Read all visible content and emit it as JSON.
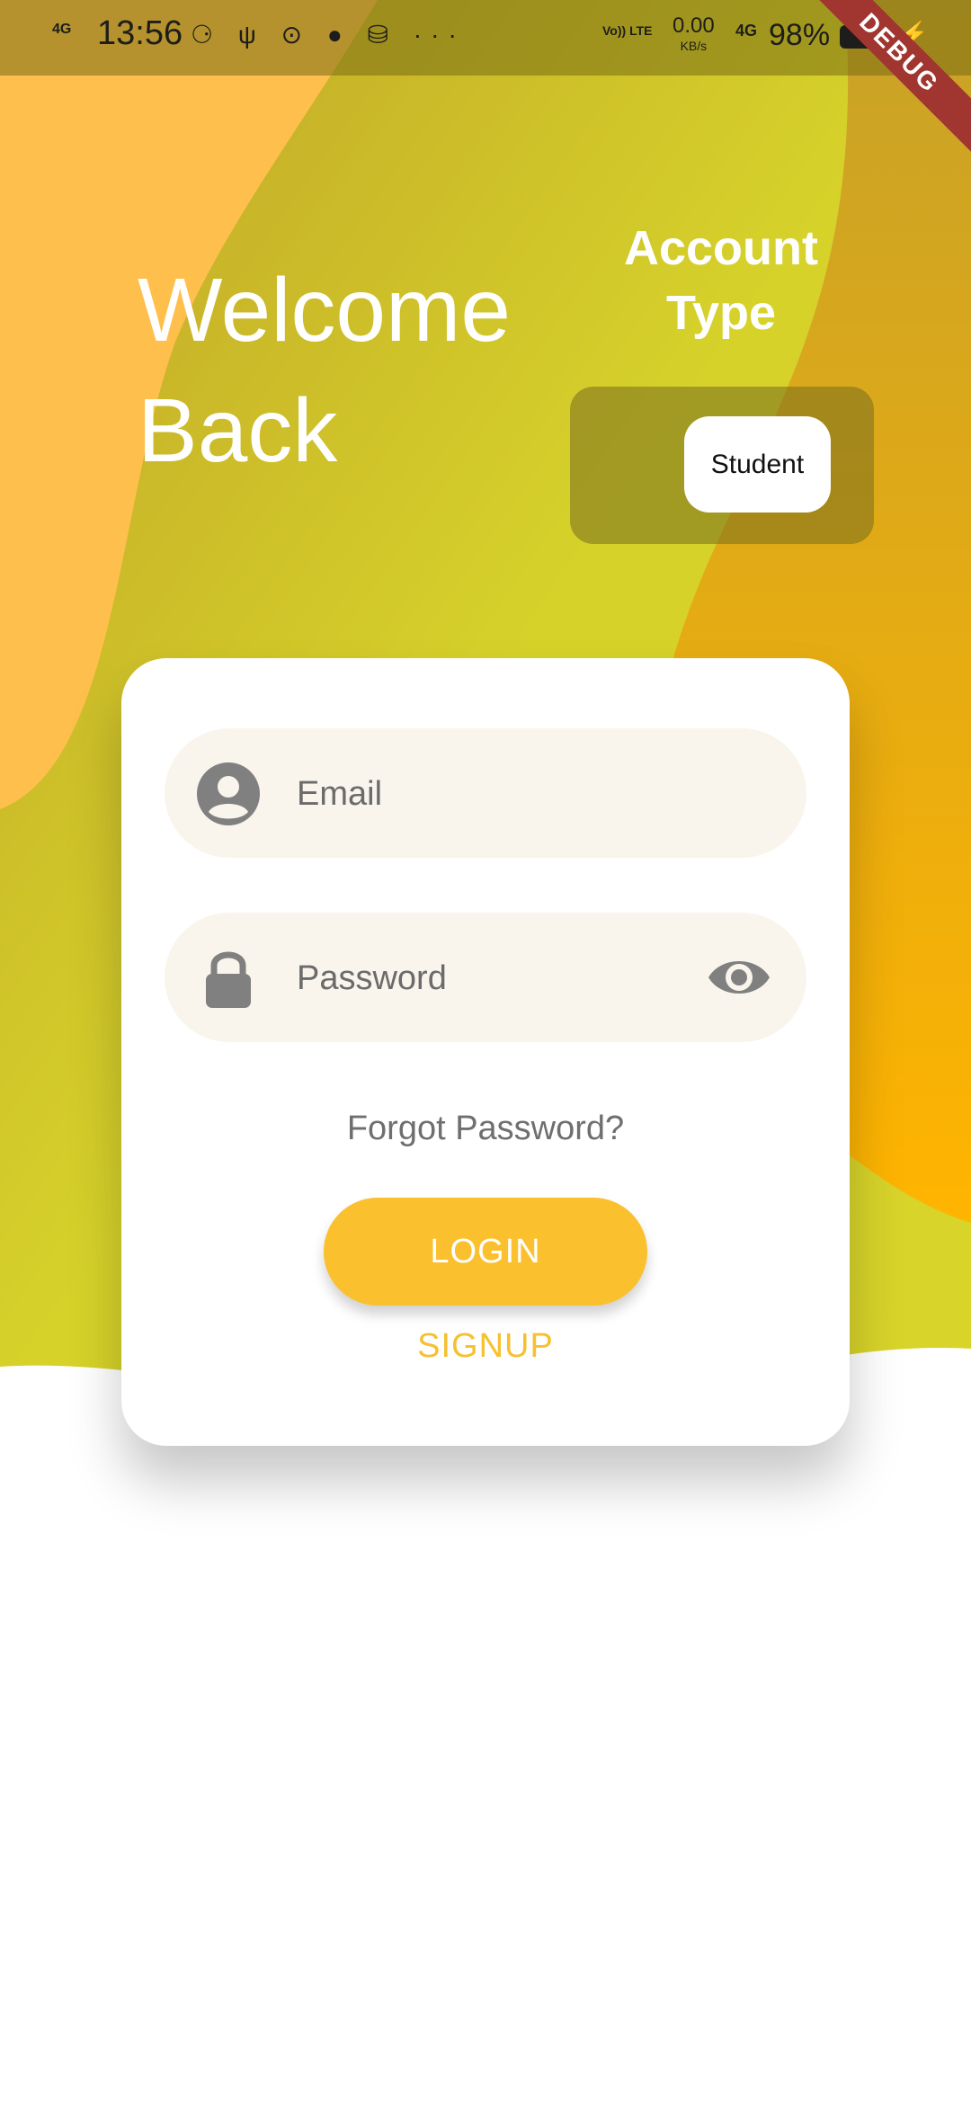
{
  "status_bar": {
    "network_type": "4G",
    "time": "13:56",
    "status_icons": "⚆ ψ ⊙ ● ⛁ ···",
    "net_speed_value": "0.00",
    "net_speed_unit": "KB/s",
    "network_type_right": "4G",
    "battery": "98%",
    "volte": "Vo)) LTE"
  },
  "debug_banner": "DEBUG",
  "welcome": {
    "line1": "Welcome",
    "line2": "Back"
  },
  "account_type": {
    "title_line1": "Account",
    "title_line2": "Type",
    "selected": "Student"
  },
  "form": {
    "email_placeholder": "Email",
    "email_value": "",
    "password_placeholder": "Password",
    "password_value": "",
    "forgot_label": "Forgot Password?",
    "login_label": "LOGIN",
    "signup_label": "SIGNUP"
  },
  "colors": {
    "accent": "#fbc02d",
    "signup_text": "#f6c030",
    "field_bg": "#f9f5ec",
    "icon_grey": "#808080"
  },
  "icons": {
    "email": "account-circle-icon",
    "password": "lock-icon",
    "visibility": "eye-icon"
  }
}
